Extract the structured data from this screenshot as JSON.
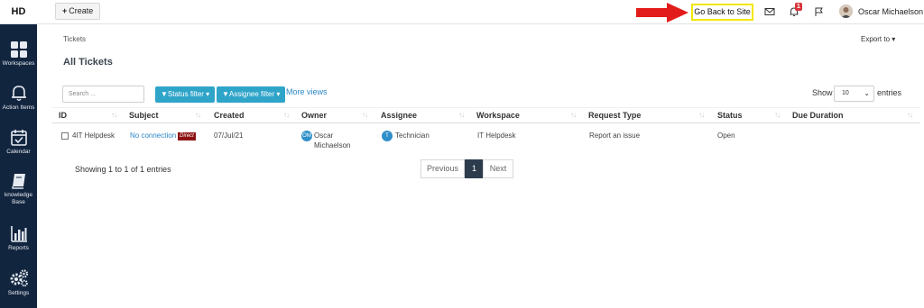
{
  "app": {
    "brand": "HD"
  },
  "topbar": {
    "create_label": "Create",
    "go_back_label": "Go Back to Site",
    "notification_count": "1",
    "user_name": "Oscar Michaelson"
  },
  "sidebar": {
    "items": [
      {
        "label": "Workspaces",
        "icon": "grid-icon"
      },
      {
        "label": "Action Items",
        "icon": "bell-icon"
      },
      {
        "label": "Calendar",
        "icon": "calendar-icon"
      },
      {
        "label": "knowledge Base",
        "icon": "book-icon"
      },
      {
        "label": "Reports",
        "icon": "bar-chart-icon"
      },
      {
        "label": "Settings",
        "icon": "gears-icon"
      }
    ]
  },
  "page": {
    "breadcrumb": "Tickets",
    "export_label": "Export to",
    "title": "All Tickets"
  },
  "toolbar": {
    "search_placeholder": "Search ...",
    "status_filter": "Status filter",
    "assignee_filter": "Assignee filter",
    "more_views": "More views",
    "show_label": "Show",
    "show_value": "10",
    "entries_label": "entries"
  },
  "table": {
    "columns": [
      "ID",
      "Subject",
      "Created",
      "Owner",
      "Assignee",
      "Workspace",
      "Request Type",
      "Status",
      "Due Duration"
    ],
    "rows": [
      {
        "id": "4IT Helpdesk",
        "subject": "No connection",
        "subject_tag": "Direct",
        "created": "07/Jul/21",
        "owner_initials": "OM",
        "owner_line1": "Oscar",
        "owner_line2": "Michaelson",
        "assignee_initials": "T",
        "assignee": "Technician",
        "workspace": "IT Helpdesk",
        "request_type": "Report an issue",
        "status": "Open",
        "due_duration": ""
      }
    ]
  },
  "footer": {
    "showing": "Showing 1 to 1 of 1 entries",
    "previous": "Previous",
    "page": "1",
    "next": "Next"
  },
  "colors": {
    "sidebar": "#12253f",
    "accent": "#2fa4c9",
    "highlight": "#f5e600",
    "arrow": "#e21b1b",
    "direct_tag": "#8b1212"
  }
}
